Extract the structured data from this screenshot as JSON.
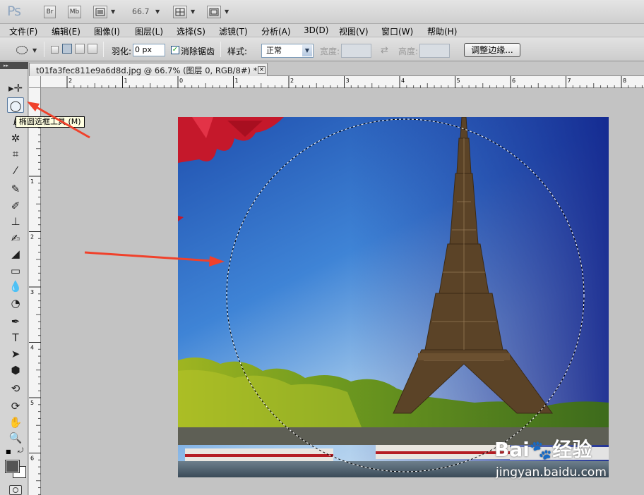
{
  "app": {
    "logo": "Ps",
    "bridge_label": "Br",
    "minibridge_label": "Mb",
    "zoom_value": "66.7"
  },
  "menu": [
    "文件(F)",
    "编辑(E)",
    "图像(I)",
    "图层(L)",
    "选择(S)",
    "滤镜(T)",
    "分析(A)",
    "3D(D)",
    "视图(V)",
    "窗口(W)",
    "帮助(H)"
  ],
  "options": {
    "feather_label": "羽化:",
    "feather_value": "0 px",
    "antialias_label": "消除锯齿",
    "antialias_checked": true,
    "style_label": "样式:",
    "style_value": "正常",
    "width_label": "宽度:",
    "height_label": "高度:",
    "refine_button": "调整边缘..."
  },
  "document": {
    "tab_title": "t01fa3fec811e9a6d8d.jpg @ 66.7% (图层 0, RGB/8#) *",
    "close": "×"
  },
  "rulers": {
    "horizontal": [
      "2",
      "1",
      "0",
      "1",
      "2",
      "3",
      "4",
      "5",
      "6",
      "7",
      "8"
    ],
    "vertical": [
      "1",
      "2",
      "3",
      "4",
      "5",
      "6"
    ]
  },
  "tooltip": "椭圆选框工具 (M)",
  "tools": [
    {
      "name": "move-tool",
      "glyph": "▸✛",
      "selected": false
    },
    {
      "name": "elliptical-marquee-tool",
      "glyph": "◯",
      "selected": true
    },
    {
      "name": "lasso-tool",
      "glyph": "ℓ",
      "selected": false
    },
    {
      "name": "quick-selection-tool",
      "glyph": "✲",
      "selected": false
    },
    {
      "name": "crop-tool",
      "glyph": "⌗",
      "selected": false
    },
    {
      "name": "eyedropper-tool",
      "glyph": "⁄",
      "selected": false
    },
    {
      "name": "spot-healing-tool",
      "glyph": "✎",
      "selected": false
    },
    {
      "name": "brush-tool",
      "glyph": "✐",
      "selected": false
    },
    {
      "name": "clone-stamp-tool",
      "glyph": "⊥",
      "selected": false
    },
    {
      "name": "history-brush-tool",
      "glyph": "✍",
      "selected": false
    },
    {
      "name": "eraser-tool",
      "glyph": "◢",
      "selected": false
    },
    {
      "name": "gradient-tool",
      "glyph": "▭",
      "selected": false
    },
    {
      "name": "blur-tool",
      "glyph": "💧",
      "selected": false
    },
    {
      "name": "dodge-tool",
      "glyph": "◔",
      "selected": false
    },
    {
      "name": "pen-tool",
      "glyph": "✒",
      "selected": false
    },
    {
      "name": "type-tool",
      "glyph": "T",
      "selected": false
    },
    {
      "name": "path-selection-tool",
      "glyph": "➤",
      "selected": false
    },
    {
      "name": "shape-tool",
      "glyph": "⬢",
      "selected": false
    },
    {
      "name": "3d-rotate-tool",
      "glyph": "⟲",
      "selected": false
    },
    {
      "name": "3d-orbit-tool",
      "glyph": "⟳",
      "selected": false
    },
    {
      "name": "hand-tool",
      "glyph": "✋",
      "selected": false
    },
    {
      "name": "zoom-tool",
      "glyph": "🔍",
      "selected": false
    }
  ],
  "watermark": {
    "brand": "Bai",
    "brand2": "经验",
    "url": "jingyan.baidu.com"
  }
}
